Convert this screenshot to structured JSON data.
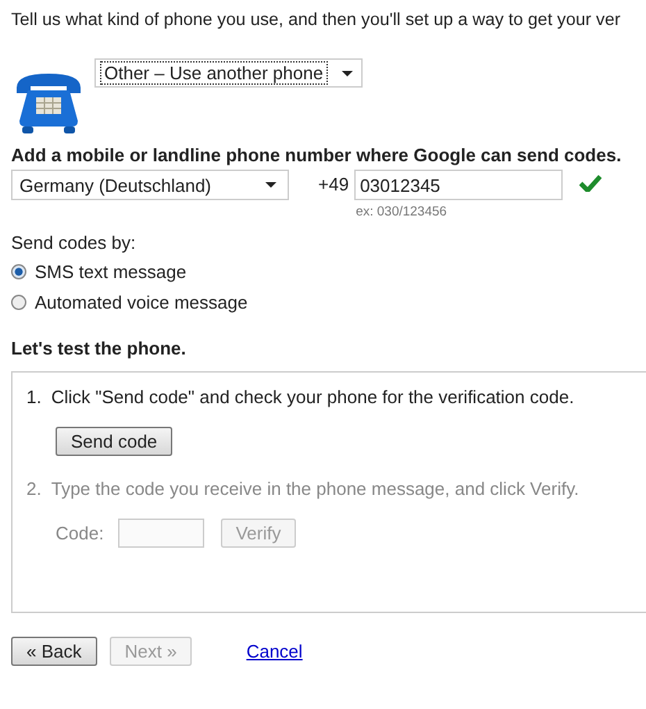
{
  "intro": "Tell us what kind of phone you use, and then you'll set up a way to get your ver",
  "phone_type": {
    "value": "Other – Use another phone"
  },
  "number_heading": "Add a mobile or landline phone number where Google can send codes.",
  "country": {
    "value": "Germany (Deutschland)"
  },
  "prefix": "+49",
  "phone_number": {
    "value": "03012345",
    "valid": true
  },
  "number_hint": "ex: 030/123456",
  "send_by_label": "Send codes by:",
  "send_options": [
    {
      "label": "SMS text message",
      "selected": true
    },
    {
      "label": "Automated voice message",
      "selected": false
    }
  ],
  "test_heading": "Let's test the phone.",
  "steps": [
    {
      "kind": "send",
      "number": "1.",
      "text": "Click \"Send code\" and check your phone for the verification code.",
      "button": "Send code",
      "disabled": false
    },
    {
      "kind": "verify",
      "number": "2.",
      "text": "Type the code you receive in the phone message, and click Verify.",
      "field_label": "Code:",
      "button": "Verify",
      "disabled": true
    }
  ],
  "nav_buttons": [
    {
      "label": "« Back",
      "disabled": false
    },
    {
      "label": "Next »",
      "disabled": true
    }
  ],
  "cancel_link": "Cancel"
}
